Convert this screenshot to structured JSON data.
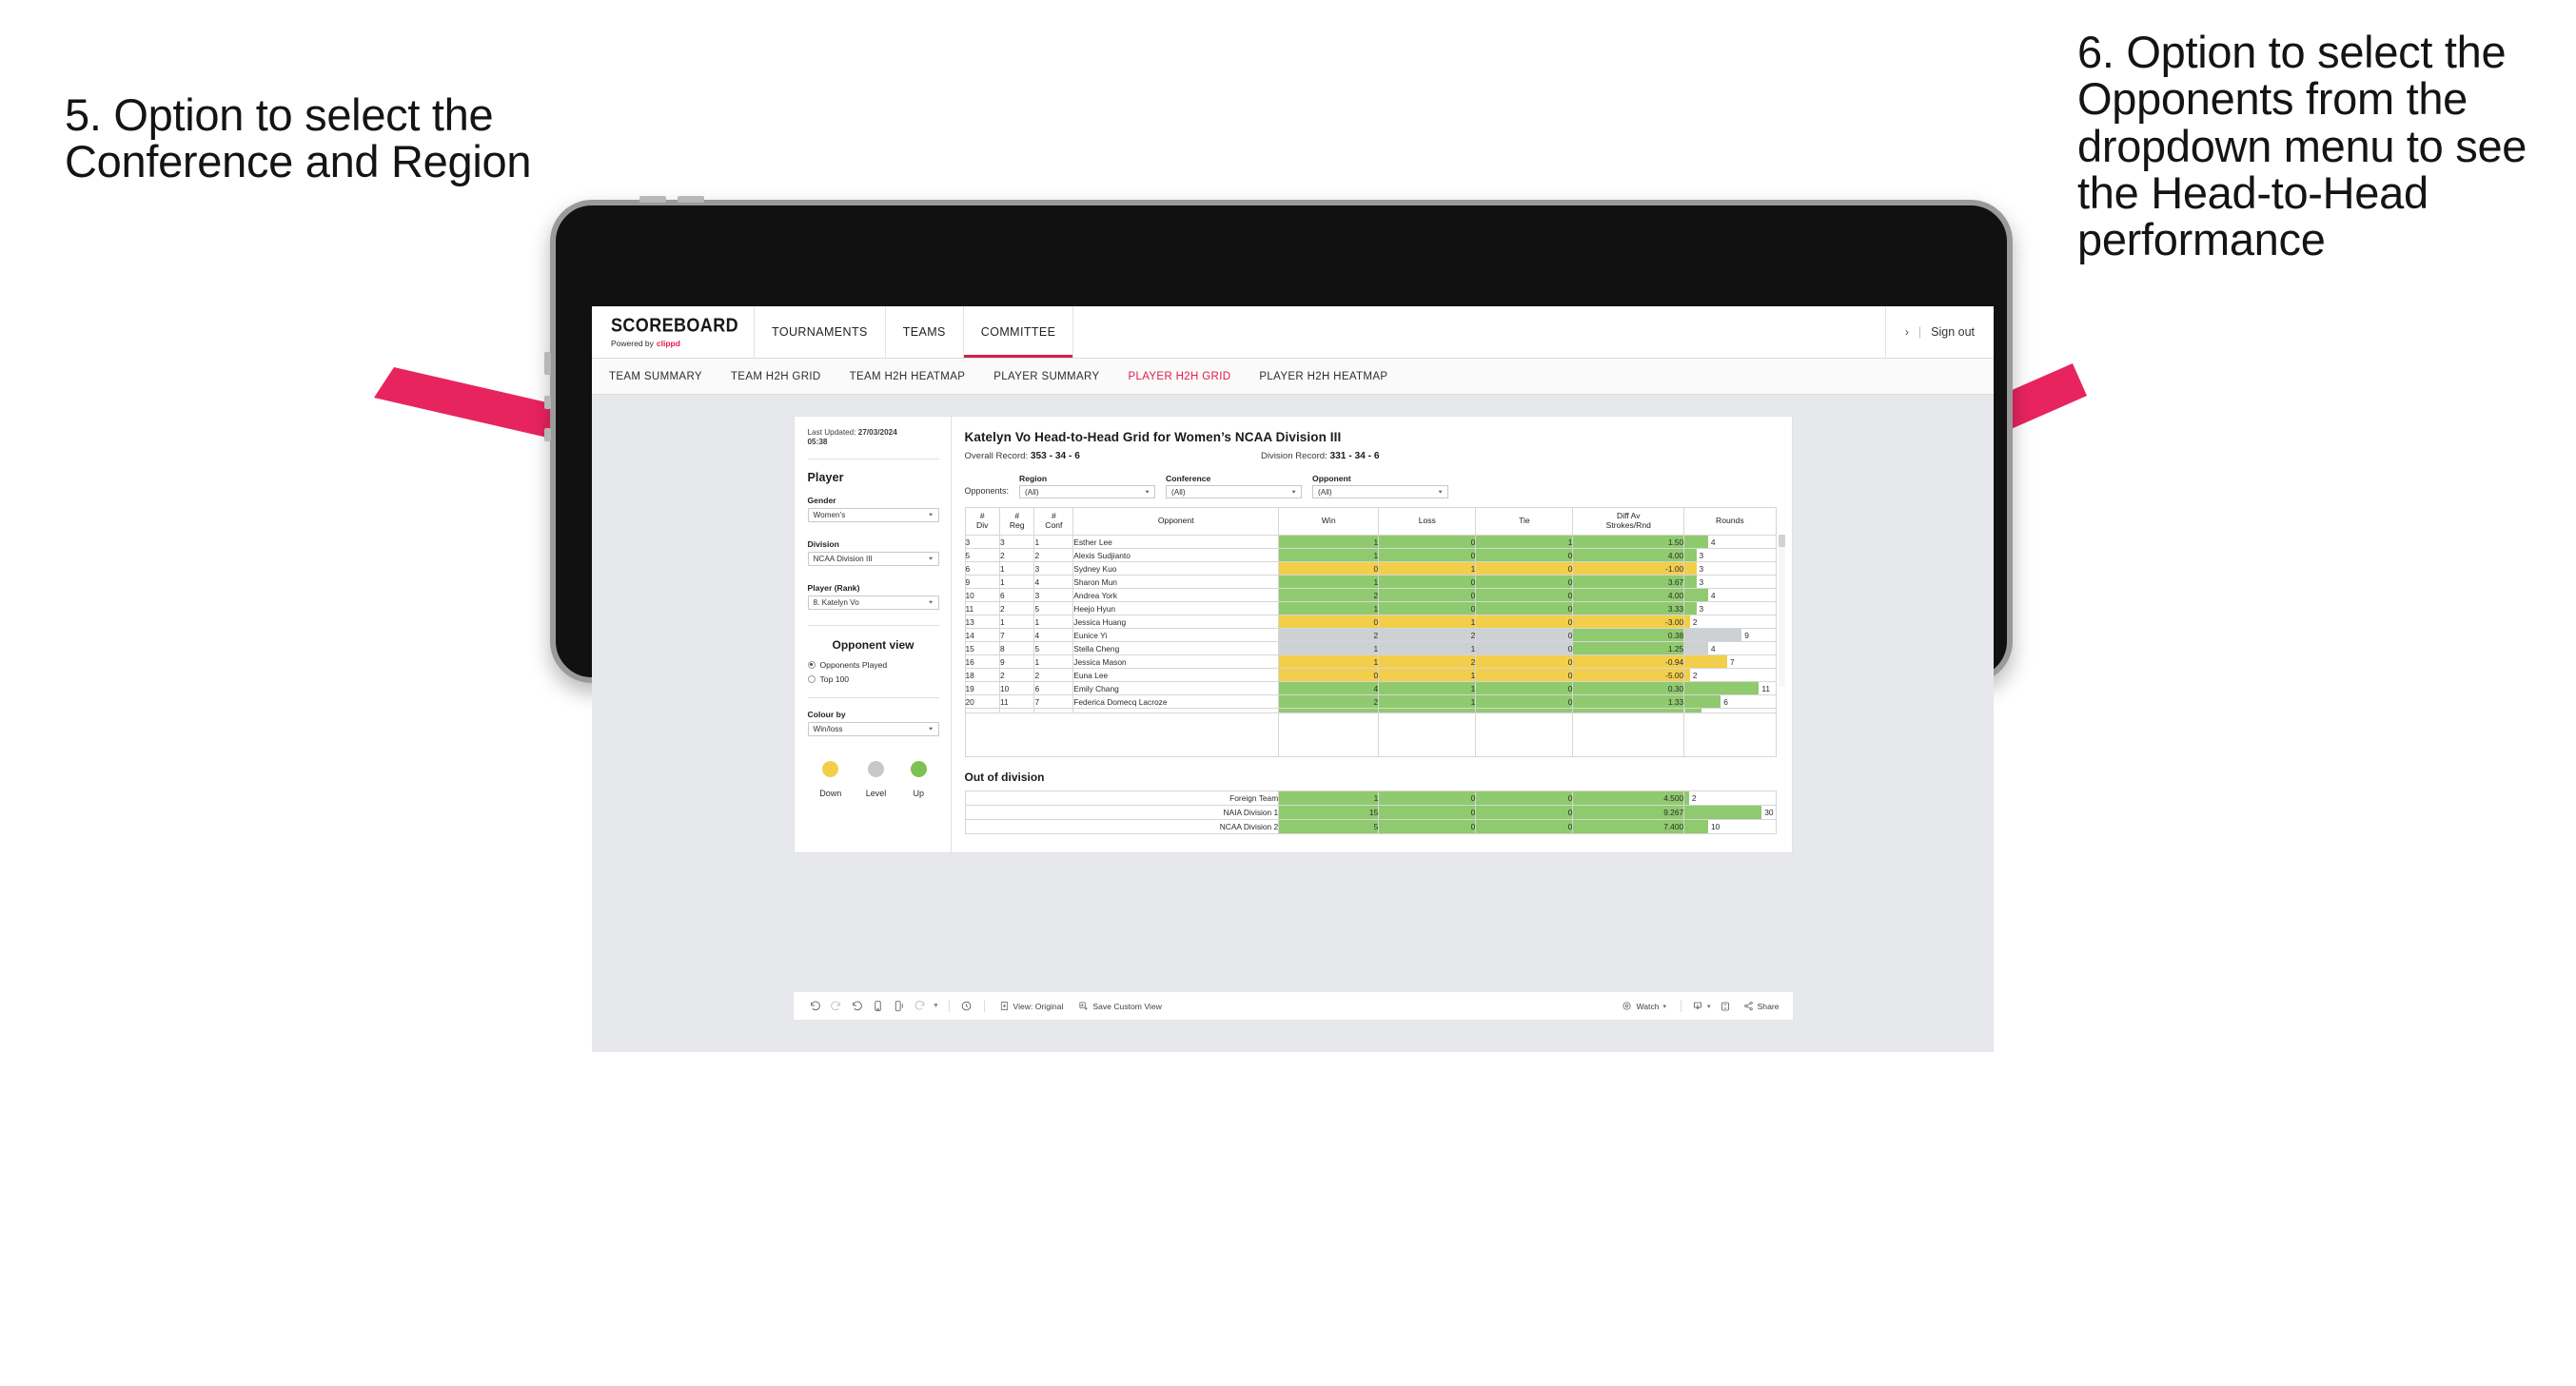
{
  "annotations": {
    "left": "5. Option to select the Conference and Region",
    "right": "6. Option to select the Opponents from the dropdown menu to see the Head-to-Head performance"
  },
  "topnav": {
    "brand": "SCOREBOARD",
    "brand_powered": "Powered by",
    "brand_name": "clippd",
    "items": [
      {
        "label": "TOURNAMENTS",
        "active": false
      },
      {
        "label": "TEAMS",
        "active": false
      },
      {
        "label": "COMMITTEE",
        "active": true
      }
    ],
    "chevron": "›",
    "separator": "|",
    "signout": "Sign out"
  },
  "subnav": {
    "items": [
      {
        "label": "TEAM SUMMARY",
        "active": false
      },
      {
        "label": "TEAM H2H GRID",
        "active": false
      },
      {
        "label": "TEAM H2H HEATMAP",
        "active": false
      },
      {
        "label": "PLAYER SUMMARY",
        "active": false
      },
      {
        "label": "PLAYER H2H GRID",
        "active": true
      },
      {
        "label": "PLAYER H2H HEATMAP",
        "active": false
      }
    ]
  },
  "sidebar": {
    "last_updated_label": "Last Updated:",
    "last_updated_value": "27/03/2024",
    "last_updated_time": "05:38",
    "player_section": "Player",
    "filters": [
      {
        "label": "Gender",
        "value": "Women’s"
      },
      {
        "label": "Division",
        "value": "NCAA Division III"
      },
      {
        "label": "Player (Rank)",
        "value": "8. Katelyn Vo"
      }
    ],
    "opponent_view": {
      "title": "Opponent view",
      "options": [
        {
          "label": "Opponents Played",
          "selected": true
        },
        {
          "label": "Top 100",
          "selected": false
        }
      ]
    },
    "colour_by": {
      "label": "Colour by",
      "value": "Win/loss"
    },
    "legend": [
      {
        "label": "Down",
        "color": "#f2ce4b"
      },
      {
        "label": "Level",
        "color": "#c5c9cc"
      },
      {
        "label": "Up",
        "color": "#7cc153"
      }
    ]
  },
  "main": {
    "title": "Katelyn Vo Head-to-Head Grid for Women’s NCAA Division III",
    "overall_record_label": "Overall Record:",
    "overall_record_value": "353 -  34 - 6",
    "division_record_label": "Division Record:",
    "division_record_value": "331 -  34 - 6",
    "opponents_label": "Opponents:",
    "filters": [
      {
        "label": "Region",
        "value": "(All)"
      },
      {
        "label": "Conference",
        "value": "(All)"
      },
      {
        "label": "Opponent",
        "value": "(All)"
      }
    ]
  },
  "chart_data": {
    "type": "table",
    "title": "Katelyn Vo Head-to-Head Grid for Women’s NCAA Division III",
    "columns": [
      "# Div",
      "# Reg",
      "# Conf",
      "Opponent",
      "Win",
      "Loss",
      "Tie",
      "Diff Av Strokes/Rnd",
      "Rounds"
    ],
    "column_headers_two_line": [
      {
        "l1": "#",
        "l2": "Div"
      },
      {
        "l1": "#",
        "l2": "Reg"
      },
      {
        "l1": "#",
        "l2": "Conf"
      },
      {
        "l1": "",
        "l2": "Opponent"
      },
      {
        "l1": "",
        "l2": "Win"
      },
      {
        "l1": "",
        "l2": "Loss"
      },
      {
        "l1": "",
        "l2": "Tie"
      },
      {
        "l1": "Diff Av",
        "l2": "Strokes/Rnd"
      },
      {
        "l1": "",
        "l2": "Rounds"
      }
    ],
    "rows": [
      {
        "div": "3",
        "reg": "3",
        "conf": "1",
        "opponent": "Esther Lee",
        "win": "1",
        "loss": "0",
        "tie": "1",
        "diff": "1.50",
        "rounds": "4",
        "color": "#8fca6e",
        "rounds_pct": 26
      },
      {
        "div": "5",
        "reg": "2",
        "conf": "2",
        "opponent": "Alexis Sudjianto",
        "win": "1",
        "loss": "0",
        "tie": "0",
        "diff": "4.00",
        "rounds": "3",
        "color": "#8fca6e",
        "rounds_pct": 13
      },
      {
        "div": "6",
        "reg": "1",
        "conf": "3",
        "opponent": "Sydney Kuo",
        "win": "0",
        "loss": "1",
        "tie": "0",
        "diff": "-1.00",
        "rounds": "3",
        "color": "#f2ce4b",
        "rounds_pct": 13
      },
      {
        "div": "9",
        "reg": "1",
        "conf": "4",
        "opponent": "Sharon Mun",
        "win": "1",
        "loss": "0",
        "tie": "0",
        "diff": "3.67",
        "rounds": "3",
        "color": "#8fca6e",
        "rounds_pct": 13
      },
      {
        "div": "10",
        "reg": "6",
        "conf": "3",
        "opponent": "Andrea York",
        "win": "2",
        "loss": "0",
        "tie": "0",
        "diff": "4.00",
        "rounds": "4",
        "color": "#8fca6e",
        "rounds_pct": 26
      },
      {
        "div": "11",
        "reg": "2",
        "conf": "5",
        "opponent": "Heejo Hyun",
        "win": "1",
        "loss": "0",
        "tie": "0",
        "diff": "3.33",
        "rounds": "3",
        "color": "#8fca6e",
        "rounds_pct": 13
      },
      {
        "div": "13",
        "reg": "1",
        "conf": "1",
        "opponent": "Jessica Huang",
        "win": "0",
        "loss": "1",
        "tie": "0",
        "diff": "-3.00",
        "rounds": "2",
        "color": "#f2ce4b",
        "rounds_pct": 6
      },
      {
        "div": "14",
        "reg": "7",
        "conf": "4",
        "opponent": "Eunice Yi",
        "win": "2",
        "loss": "2",
        "tie": "0",
        "diff": "0.38",
        "rounds": "9",
        "color": "#cdd1d4",
        "rounds_pct": 63,
        "diff_color": "#8fca6e"
      },
      {
        "div": "15",
        "reg": "8",
        "conf": "5",
        "opponent": "Stella Cheng",
        "win": "1",
        "loss": "1",
        "tie": "0",
        "diff": "1.25",
        "rounds": "4",
        "color": "#cdd1d4",
        "rounds_pct": 26,
        "diff_color": "#8fca6e"
      },
      {
        "div": "16",
        "reg": "9",
        "conf": "1",
        "opponent": "Jessica Mason",
        "win": "1",
        "loss": "2",
        "tie": "0",
        "diff": "-0.94",
        "rounds": "7",
        "color": "#f2ce4b",
        "rounds_pct": 47
      },
      {
        "div": "18",
        "reg": "2",
        "conf": "2",
        "opponent": "Euna Lee",
        "win": "0",
        "loss": "1",
        "tie": "0",
        "diff": "-5.00",
        "rounds": "2",
        "color": "#f2ce4b",
        "rounds_pct": 6
      },
      {
        "div": "19",
        "reg": "10",
        "conf": "6",
        "opponent": "Emily Chang",
        "win": "4",
        "loss": "1",
        "tie": "0",
        "diff": "0.30",
        "rounds": "11",
        "color": "#8fca6e",
        "rounds_pct": 82
      },
      {
        "div": "20",
        "reg": "11",
        "conf": "7",
        "opponent": "Federica Domecq Lacroze",
        "win": "2",
        "loss": "1",
        "tie": "0",
        "diff": "1.33",
        "rounds": "6",
        "color": "#8fca6e",
        "rounds_pct": 40
      }
    ],
    "out_of_division": {
      "title": "Out of division",
      "rows": [
        {
          "name": "Foreign Team",
          "win": "1",
          "loss": "0",
          "tie": "0",
          "diff": "4.500",
          "rounds": "2",
          "color": "#8fca6e",
          "rounds_pct": 5
        },
        {
          "name": "NAIA Division 1",
          "win": "15",
          "loss": "0",
          "tie": "0",
          "diff": "9.267",
          "rounds": "30",
          "color": "#8fca6e",
          "rounds_pct": 85
        },
        {
          "name": "NCAA Division 2",
          "win": "5",
          "loss": "0",
          "tie": "0",
          "diff": "7.400",
          "rounds": "10",
          "color": "#8fca6e",
          "rounds_pct": 26
        }
      ]
    }
  },
  "toolbar": {
    "view_label": "View: Original",
    "save_label": "Save Custom View",
    "watch_label": "Watch",
    "share_label": "Share",
    "caret": "▾"
  },
  "colors": {
    "accent": "#e4194e",
    "green": "#8fca6e",
    "yellow": "#f2ce4b",
    "grey": "#cdd1d4",
    "arrow": "#e8245f"
  }
}
